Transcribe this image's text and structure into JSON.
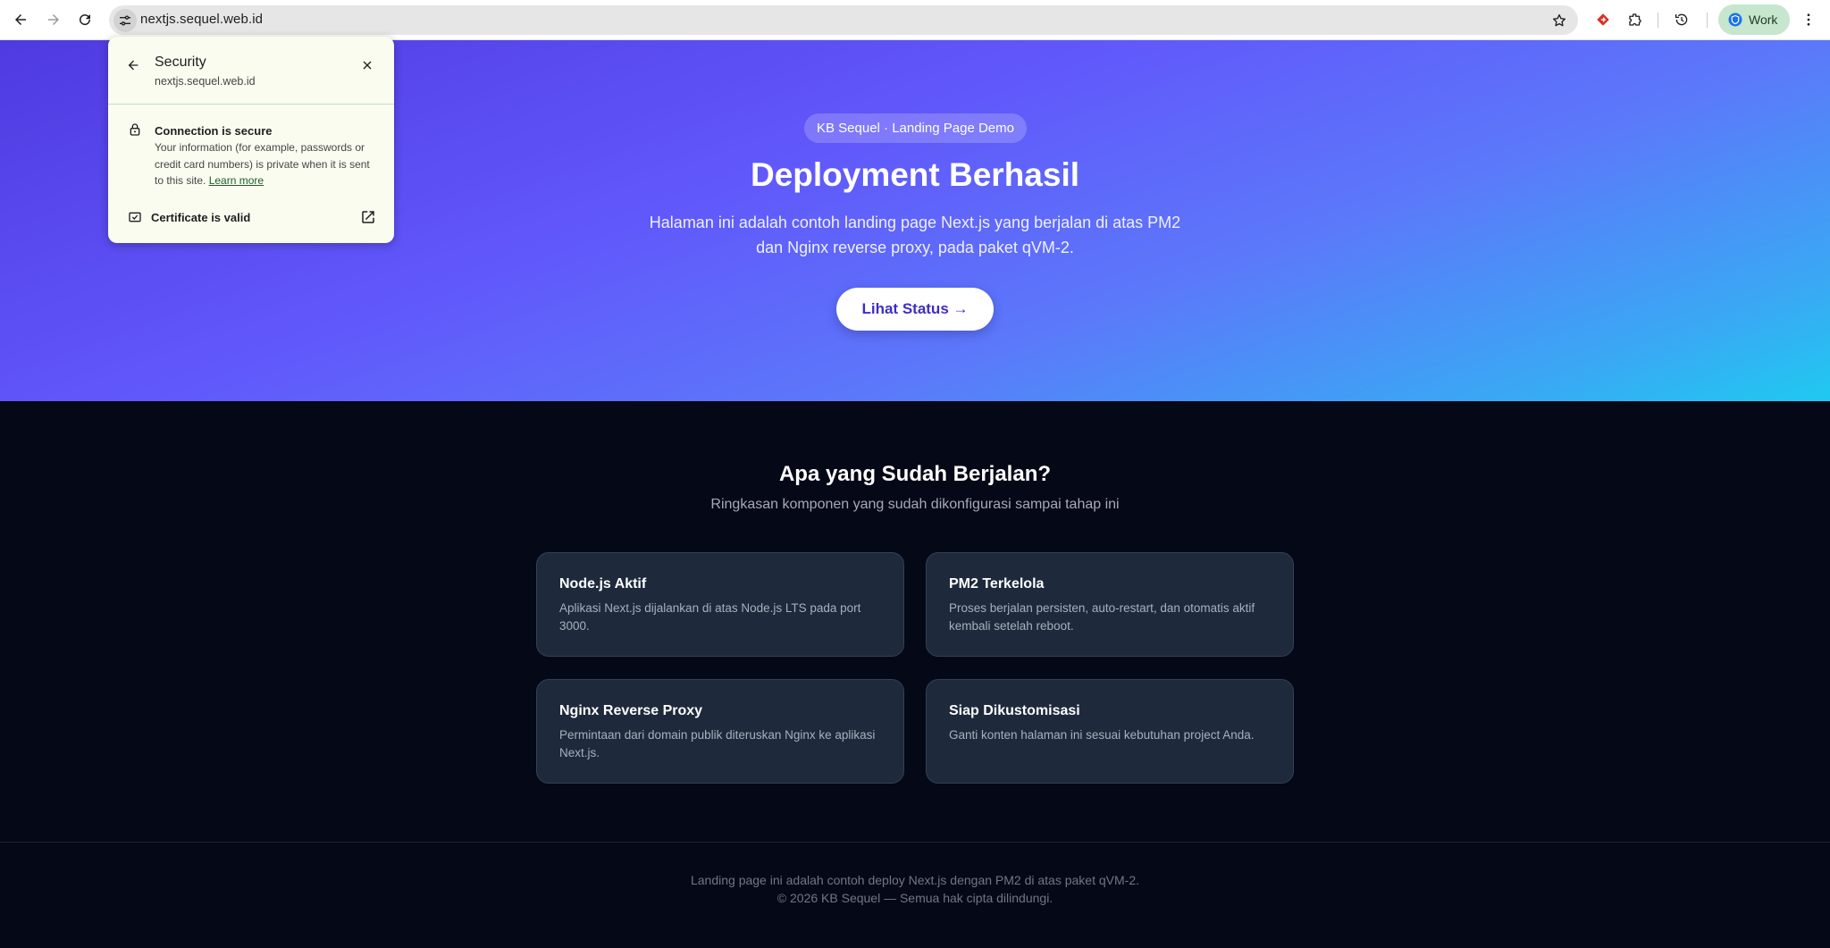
{
  "browser": {
    "url": "nextjs.sequel.web.id",
    "profile_label": "Work"
  },
  "icons": {
    "back": "arrow-left-icon",
    "forward": "arrow-right-icon",
    "reload": "reload-icon",
    "site_info": "tune-icon",
    "bookmark": "star-icon",
    "extension_red": "red-diamond-extension-icon",
    "extensions": "puzzle-icon",
    "history": "history-icon",
    "menu": "kebab-menu-icon"
  },
  "security_popup": {
    "title": "Security",
    "domain": "nextjs.sequel.web.id",
    "connection_title": "Connection is secure",
    "connection_desc": "Your information (for example, passwords or credit card numbers) is private when it is sent to this site.",
    "learn_more": "Learn more",
    "certificate_label": "Certificate is valid"
  },
  "hero": {
    "badge": "KB Sequel · Landing Page Demo",
    "title": "Deployment Berhasil",
    "subtitle": "Halaman ini adalah contoh landing page Next.js yang berjalan di atas PM2 dan Nginx reverse proxy, pada paket qVM-2.",
    "cta": "Lihat Status →"
  },
  "features": {
    "title": "Apa yang Sudah Berjalan?",
    "subtitle": "Ringkasan komponen yang sudah dikonfigurasi sampai tahap ini",
    "cards": [
      {
        "title": "Node.js Aktif",
        "desc": "Aplikasi Next.js dijalankan di atas Node.js LTS pada port 3000."
      },
      {
        "title": "PM2 Terkelola",
        "desc": "Proses berjalan persisten, auto-restart, dan otomatis aktif kembali setelah reboot."
      },
      {
        "title": "Nginx Reverse Proxy",
        "desc": "Permintaan dari domain publik diteruskan Nginx ke aplikasi Next.js."
      },
      {
        "title": "Siap Dikustomisasi",
        "desc": "Ganti konten halaman ini sesuai kebutuhan project Anda."
      }
    ]
  },
  "footer": {
    "line1": "Landing page ini adalah contoh deploy Next.js dengan PM2 di atas paket qVM-2.",
    "line2": "© 2026 KB Sequel — Semua hak cipta dilindungi."
  }
}
